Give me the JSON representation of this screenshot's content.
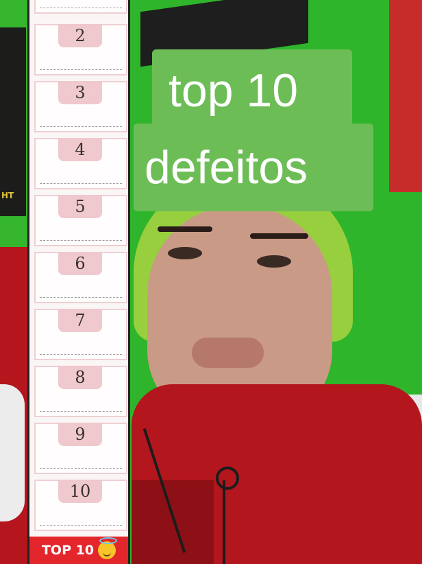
{
  "caption": {
    "line1": "top 10",
    "line2": "defeitos"
  },
  "ranking": {
    "slots": [
      "2",
      "3",
      "4",
      "5",
      "6",
      "7",
      "8",
      "9",
      "10"
    ],
    "banner_label": "TOP 10",
    "banner_icon": "smiling-face-with-halo-icon"
  },
  "background": {
    "left_poster_text": "HT",
    "colors": {
      "wall": "#2fb52b",
      "caption_bg": "#6dbd57",
      "banner": "#e3262c",
      "slot_tab": "#efc9cd",
      "hoodie": "#b3161d",
      "beanie": "#97cf3e"
    }
  }
}
